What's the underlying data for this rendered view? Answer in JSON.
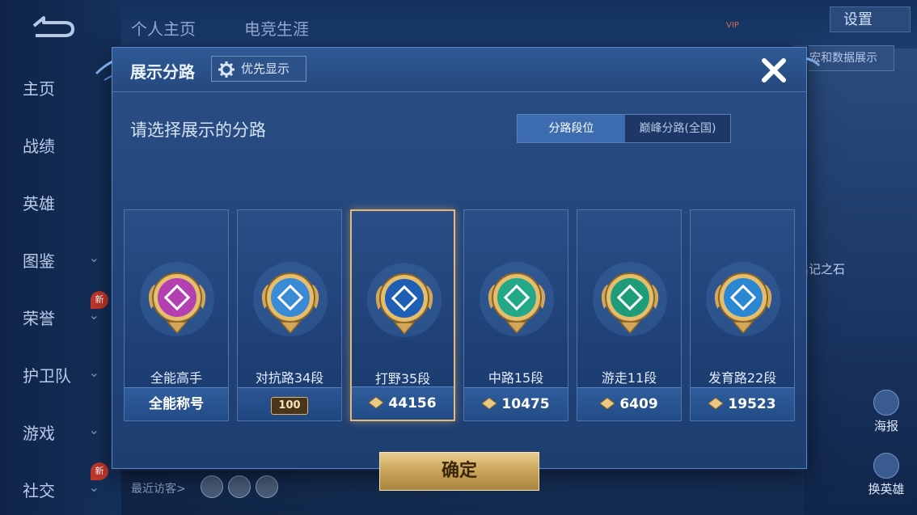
{
  "nav": {
    "items": [
      {
        "label": "主页",
        "chevron": false,
        "badge": ""
      },
      {
        "label": "战绩",
        "chevron": false,
        "badge": ""
      },
      {
        "label": "英雄",
        "chevron": false,
        "badge": ""
      },
      {
        "label": "图鉴",
        "chevron": true,
        "badge": ""
      },
      {
        "label": "荣誉",
        "chevron": true,
        "badge": "新"
      },
      {
        "label": "护卫队",
        "chevron": true,
        "badge": ""
      },
      {
        "label": "游戏",
        "chevron": true,
        "badge": ""
      },
      {
        "label": "社交",
        "chevron": true,
        "badge": "新"
      }
    ]
  },
  "top_tabs": [
    "个人主页",
    "电竞生涯"
  ],
  "top_right": {
    "vip_label": "VIP",
    "settings_label": "设置",
    "data_display_label": "宏和数据展示"
  },
  "background": {
    "stone_label": "铭记之石",
    "poster_label": "海报",
    "swap_hero_label": "换英雄",
    "recent_visitors_label": "最近访客>"
  },
  "modal": {
    "title": "展示分路",
    "priority_label": "优先显示",
    "subtitle": "请选择展示的分路",
    "segments": [
      {
        "label": "分路段位",
        "active": true
      },
      {
        "label": "巅峰分路(全国)",
        "active": false
      }
    ],
    "cards": [
      {
        "lane": "全能高手",
        "footer": "全能称号",
        "footer_type": "text",
        "selected": false,
        "emblem_color": "#b43fb0",
        "emblem_icon": "allround-icon"
      },
      {
        "lane": "对抗路34段",
        "footer": "100",
        "footer_type": "badge",
        "selected": false,
        "emblem_color": "#3a8ad6",
        "emblem_icon": "clash-lane-icon"
      },
      {
        "lane": "打野35段",
        "footer": "44156",
        "footer_type": "points",
        "selected": true,
        "emblem_color": "#1e5fb5",
        "emblem_icon": "jungle-dragon-icon"
      },
      {
        "lane": "中路15段",
        "footer": "10475",
        "footer_type": "points",
        "selected": false,
        "emblem_color": "#23a889",
        "emblem_icon": "mid-lane-icon"
      },
      {
        "lane": "游走11段",
        "footer": "6409",
        "footer_type": "points",
        "selected": false,
        "emblem_color": "#1f9c7a",
        "emblem_icon": "roam-wings-icon"
      },
      {
        "lane": "发育路22段",
        "footer": "19523",
        "footer_type": "points",
        "selected": false,
        "emblem_color": "#2b86d4",
        "emblem_icon": "farm-lane-icon"
      }
    ],
    "confirm_label": "确定"
  }
}
